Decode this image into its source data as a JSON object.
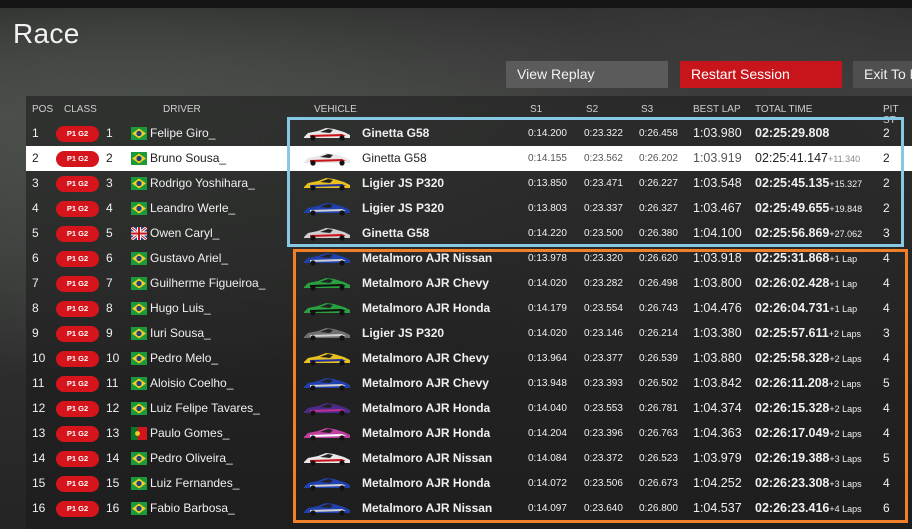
{
  "title": "Race",
  "buttons": {
    "view_replay": "View Replay",
    "restart_session": "Restart Session",
    "exit": "Exit To M"
  },
  "columns": {
    "pos": "POS",
    "class": "CLASS",
    "driver": "DRIVER",
    "vehicle": "VEHICLE",
    "s1": "S1",
    "s2": "S2",
    "s3": "S3",
    "best_lap": "BEST LAP",
    "total_time": "TOTAL TIME",
    "pit_stops": "PIT ST"
  },
  "class_label": "P1 G2",
  "rows": [
    {
      "pos": "1",
      "num": "1",
      "flag": "brazil",
      "driver": "Felipe Giro_",
      "vehicle": "Ginetta G58",
      "livery": "white",
      "s1": "0:14.200",
      "s2": "0:23.322",
      "s3": "0:26.458",
      "best": "1:03.980",
      "total": "02:25:29.808",
      "gap": "",
      "pit": "2"
    },
    {
      "pos": "2",
      "num": "2",
      "flag": "brazil",
      "driver": "Bruno Sousa_",
      "vehicle": "Ginetta G58",
      "livery": "white",
      "s1": "0:14.155",
      "s2": "0:23.562",
      "s3": "0:26.202",
      "best": "1:03.919",
      "total": "02:25:41.147",
      "gap": "+11.340",
      "pit": "2",
      "highlight": true
    },
    {
      "pos": "3",
      "num": "3",
      "flag": "brazil",
      "driver": "Rodrigo Yoshihara_",
      "vehicle": "Ligier JS P320",
      "livery": "yellow",
      "s1": "0:13.850",
      "s2": "0:23.471",
      "s3": "0:26.227",
      "best": "1:03.548",
      "total": "02:25:45.135",
      "gap": "+15.327",
      "pit": "2"
    },
    {
      "pos": "4",
      "num": "4",
      "flag": "brazil",
      "driver": "Leandro Werle_",
      "vehicle": "Ligier JS P320",
      "livery": "blue",
      "s1": "0:13.803",
      "s2": "0:23.337",
      "s3": "0:26.327",
      "best": "1:03.467",
      "total": "02:25:49.655",
      "gap": "+19.848",
      "pit": "2"
    },
    {
      "pos": "5",
      "num": "5",
      "flag": "uk",
      "driver": "Owen Caryl_",
      "vehicle": "Ginetta G58",
      "livery": "red",
      "s1": "0:14.220",
      "s2": "0:23.500",
      "s3": "0:26.380",
      "best": "1:04.100",
      "total": "02:25:56.869",
      "gap": "+27.062",
      "pit": "3"
    },
    {
      "pos": "6",
      "num": "6",
      "flag": "brazil",
      "driver": "Gustavo Ariel_",
      "vehicle": "Metalmoro AJR Nissan",
      "livery": "blue",
      "s1": "0:13.978",
      "s2": "0:23.320",
      "s3": "0:26.620",
      "best": "1:03.918",
      "total": "02:25:31.868",
      "gap": "+1 Lap",
      "pit": "4"
    },
    {
      "pos": "7",
      "num": "7",
      "flag": "brazil",
      "driver": "Guilherme Figueiroa_",
      "vehicle": "Metalmoro AJR Chevy",
      "livery": "green",
      "s1": "0:14.020",
      "s2": "0:23.282",
      "s3": "0:26.498",
      "best": "1:03.800",
      "total": "02:26:02.428",
      "gap": "+1 Lap",
      "pit": "4"
    },
    {
      "pos": "8",
      "num": "8",
      "flag": "brazil",
      "driver": "Hugo Luis_",
      "vehicle": "Metalmoro AJR Honda",
      "livery": "green",
      "s1": "0:14.179",
      "s2": "0:23.554",
      "s3": "0:26.743",
      "best": "1:04.476",
      "total": "02:26:04.731",
      "gap": "+1 Lap",
      "pit": "4"
    },
    {
      "pos": "9",
      "num": "9",
      "flag": "brazil",
      "driver": "Iuri Sousa_",
      "vehicle": "Ligier JS P320",
      "livery": "grey",
      "s1": "0:14.020",
      "s2": "0:23.146",
      "s3": "0:26.214",
      "best": "1:03.380",
      "total": "02:25:57.611",
      "gap": "+2 Laps",
      "pit": "3"
    },
    {
      "pos": "10",
      "num": "10",
      "flag": "brazil",
      "driver": "Pedro Melo_",
      "vehicle": "Metalmoro AJR Chevy",
      "livery": "yellow",
      "s1": "0:13.964",
      "s2": "0:23.377",
      "s3": "0:26.539",
      "best": "1:03.880",
      "total": "02:25:58.328",
      "gap": "+2 Laps",
      "pit": "4"
    },
    {
      "pos": "11",
      "num": "11",
      "flag": "brazil",
      "driver": "Aloisio Coelho_",
      "vehicle": "Metalmoro AJR Chevy",
      "livery": "blue",
      "s1": "0:13.948",
      "s2": "0:23.393",
      "s3": "0:26.502",
      "best": "1:03.842",
      "total": "02:26:11.208",
      "gap": "+2 Laps",
      "pit": "5"
    },
    {
      "pos": "12",
      "num": "12",
      "flag": "brazil",
      "driver": "Luiz Felipe Tavares_",
      "vehicle": "Metalmoro AJR Honda",
      "livery": "purple",
      "s1": "0:14.040",
      "s2": "0:23.553",
      "s3": "0:26.781",
      "best": "1:04.374",
      "total": "02:26:15.328",
      "gap": "+2 Laps",
      "pit": "4"
    },
    {
      "pos": "13",
      "num": "13",
      "flag": "portugal",
      "driver": "Paulo Gomes_",
      "vehicle": "Metalmoro AJR Honda",
      "livery": "pink",
      "s1": "0:14.204",
      "s2": "0:23.396",
      "s3": "0:26.763",
      "best": "1:04.363",
      "total": "02:26:17.049",
      "gap": "+2 Laps",
      "pit": "4"
    },
    {
      "pos": "14",
      "num": "14",
      "flag": "brazil",
      "driver": "Pedro Oliveira_",
      "vehicle": "Metalmoro AJR Nissan",
      "livery": "white",
      "s1": "0:14.084",
      "s2": "0:23.372",
      "s3": "0:26.523",
      "best": "1:03.979",
      "total": "02:26:19.388",
      "gap": "+3 Laps",
      "pit": "5"
    },
    {
      "pos": "15",
      "num": "15",
      "flag": "brazil",
      "driver": "Luiz Fernandes_",
      "vehicle": "Metalmoro AJR Honda",
      "livery": "blue",
      "s1": "0:14.072",
      "s2": "0:23.506",
      "s3": "0:26.673",
      "best": "1:04.252",
      "total": "02:26:23.308",
      "gap": "+3 Laps",
      "pit": "4"
    },
    {
      "pos": "16",
      "num": "16",
      "flag": "brazil",
      "driver": "Fabio Barbosa_",
      "vehicle": "Metalmoro AJR Nissan",
      "livery": "blue",
      "s1": "0:14.097",
      "s2": "0:23.640",
      "s3": "0:26.800",
      "best": "1:04.537",
      "total": "02:26:23.416",
      "gap": "+4 Laps",
      "pit": "6"
    }
  ],
  "colors": {
    "class_badge": "#d6141c",
    "restart": "#c8141b",
    "box_top": "#87c8e4",
    "box_bottom": "#f07f27"
  }
}
